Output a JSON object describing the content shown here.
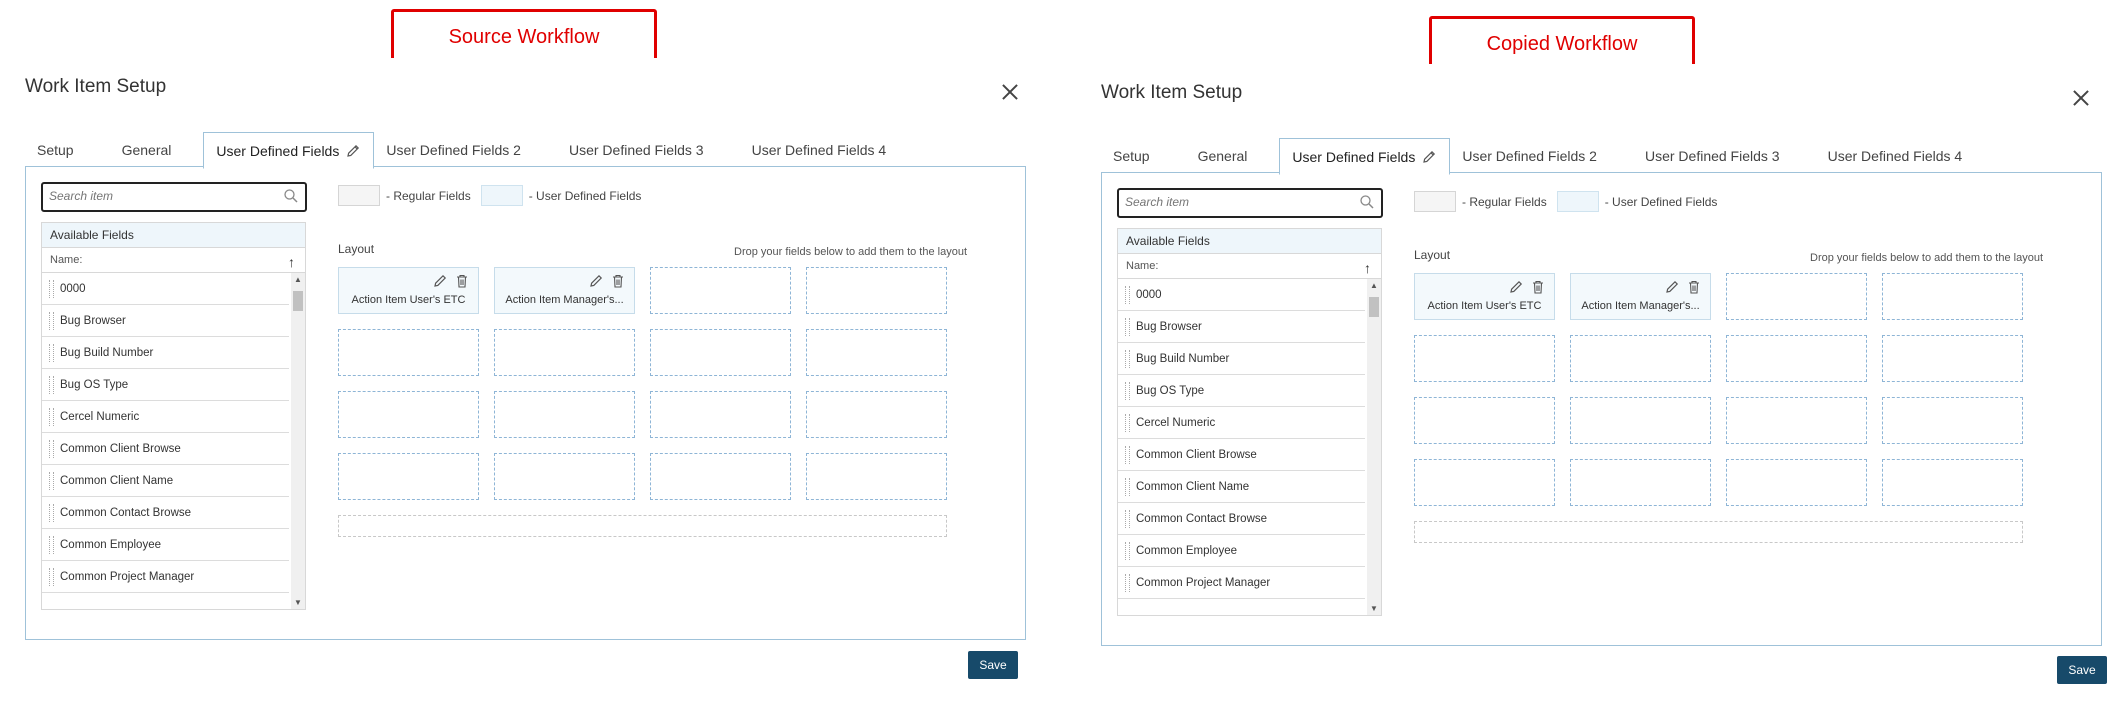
{
  "callouts": {
    "left": "Source Workflow",
    "right": "Copied Workflow"
  },
  "dialog": {
    "title": "Work Item Setup",
    "tabs": [
      "Setup",
      "General",
      "User Defined Fields",
      "User Defined Fields 2",
      "User Defined Fields 3",
      "User Defined Fields 4"
    ],
    "active_tab": "User Defined Fields",
    "search_placeholder": "Search item",
    "legend": {
      "regular": "- Regular Fields",
      "user_defined": "- User Defined Fields"
    },
    "available_fields_title": "Available Fields",
    "name_column": "Name:",
    "available_fields": [
      "0000",
      "Bug Browser",
      "Bug Build Number",
      "Bug OS Type",
      "Cercel Numeric",
      "Common Client Browse",
      "Common Client Name",
      "Common Contact Browse",
      "Common Employee",
      "Common Project Manager"
    ],
    "layout_label": "Layout",
    "drop_hint": "Drop your fields below to add them to the layout",
    "layout_fields": [
      "Action Item User's ETC",
      "Action Item Manager's..."
    ],
    "save_label": "Save"
  },
  "colors": {
    "accent": "#174a6a",
    "callout_red": "#e00000",
    "tab_border": "#9fc2d9",
    "slot_border": "#8eb5d6"
  },
  "icons": {
    "close": "close-icon",
    "search": "search-icon",
    "edit": "pencil-icon",
    "delete": "trash-icon",
    "sort": "arrow-up-icon"
  }
}
